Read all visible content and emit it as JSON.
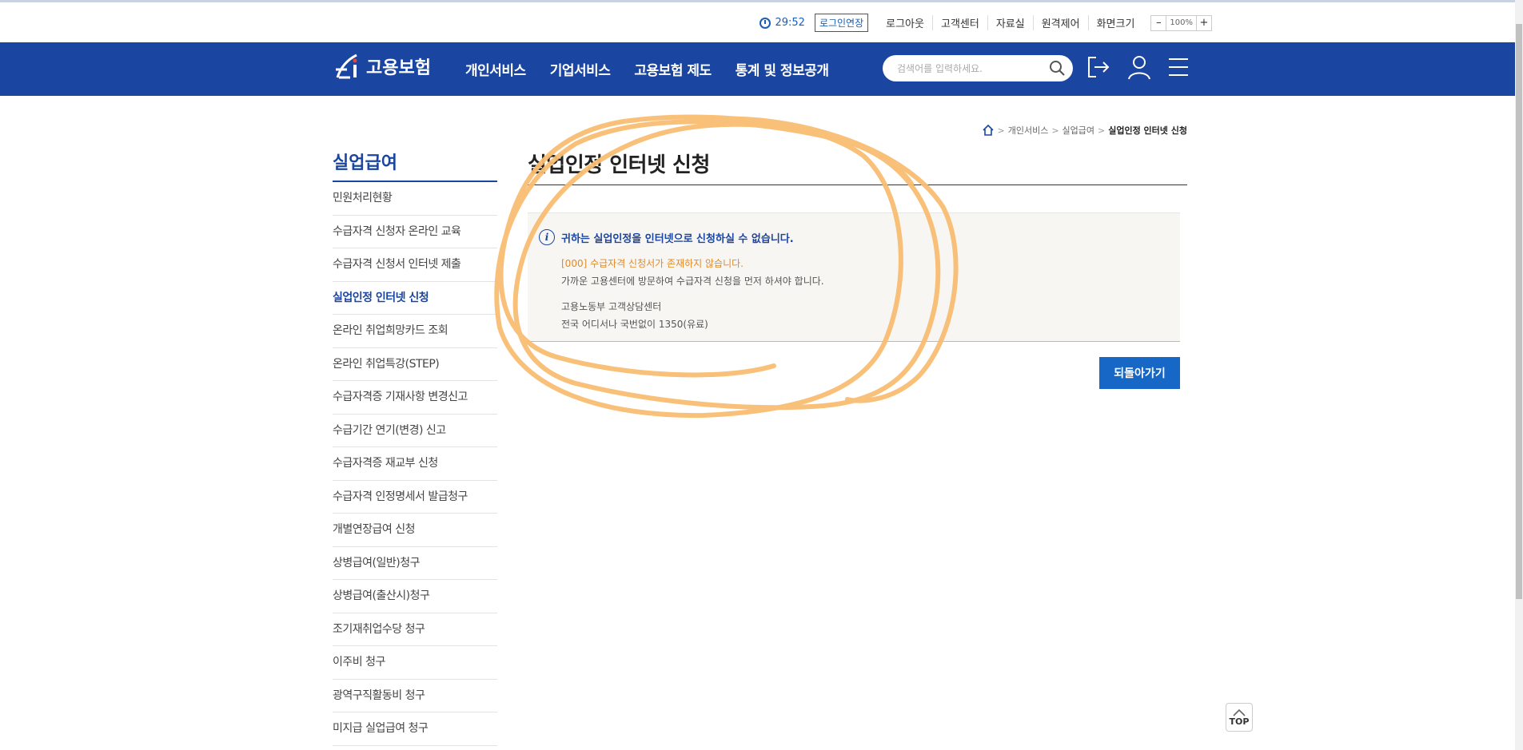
{
  "topbar": {
    "timer": "29:52",
    "login_extend": "로그인연장",
    "links": [
      "로그아웃",
      "고객센터",
      "자료실",
      "원격제어",
      "화면크기"
    ],
    "zoom_minus": "–",
    "zoom_value": "100%",
    "zoom_plus": "+"
  },
  "header": {
    "logo_text": "고용보험",
    "menu": [
      "개인서비스",
      "기업서비스",
      "고용보험 제도",
      "통계 및 정보공개"
    ],
    "search_placeholder": "검색어를 입력하세요.",
    "icons": [
      "search-icon",
      "logout-icon",
      "user-icon",
      "hamburger-menu-icon"
    ],
    "brand_color": "#1a45a0"
  },
  "breadcrumb": {
    "items": [
      "개인서비스",
      "실업급여"
    ],
    "current": "실업인정 인터넷 신청"
  },
  "sidebar": {
    "title": "실업급여",
    "items": [
      "민원처리현황",
      "수급자격 신청자 온라인 교육",
      "수급자격 신청서 인터넷 제출",
      "실업인정 인터넷 신청",
      "온라인 취업희망카드 조회",
      "온라인 취업특강(STEP)",
      "수급자격증 기재사항 변경신고",
      "수급기간 연기(변경) 신고",
      "수급자격증 재교부 신청",
      "수급자격 인정명세서 발급청구",
      "개별연장급여 신청",
      "상병급여(일반)청구",
      "상병급여(출산시)청구",
      "조기재취업수당 청구",
      "이주비 청구",
      "광역구직활동비 청구",
      "미지급 실업급여 청구"
    ],
    "active_index": 3
  },
  "main": {
    "title": "실업인정 인터넷 신청",
    "message_head": "귀하는 실업인정을 인터넷으로 신청하실 수 없습니다.",
    "error_line": "[000] 수급자격 신청서가 존재하지 않습니다.",
    "guide_line": "가까운 고용센터에 방문하여 수급자격 신청을 먼저 하셔야 합니다.",
    "contact_name": "고용노동부 고객상담센터",
    "contact_phone": "전국 어디서나 국번없이 1350(유료)",
    "back_button": "되돌아가기"
  },
  "top_button": "TOP",
  "annotation_color": "#f9bd72"
}
